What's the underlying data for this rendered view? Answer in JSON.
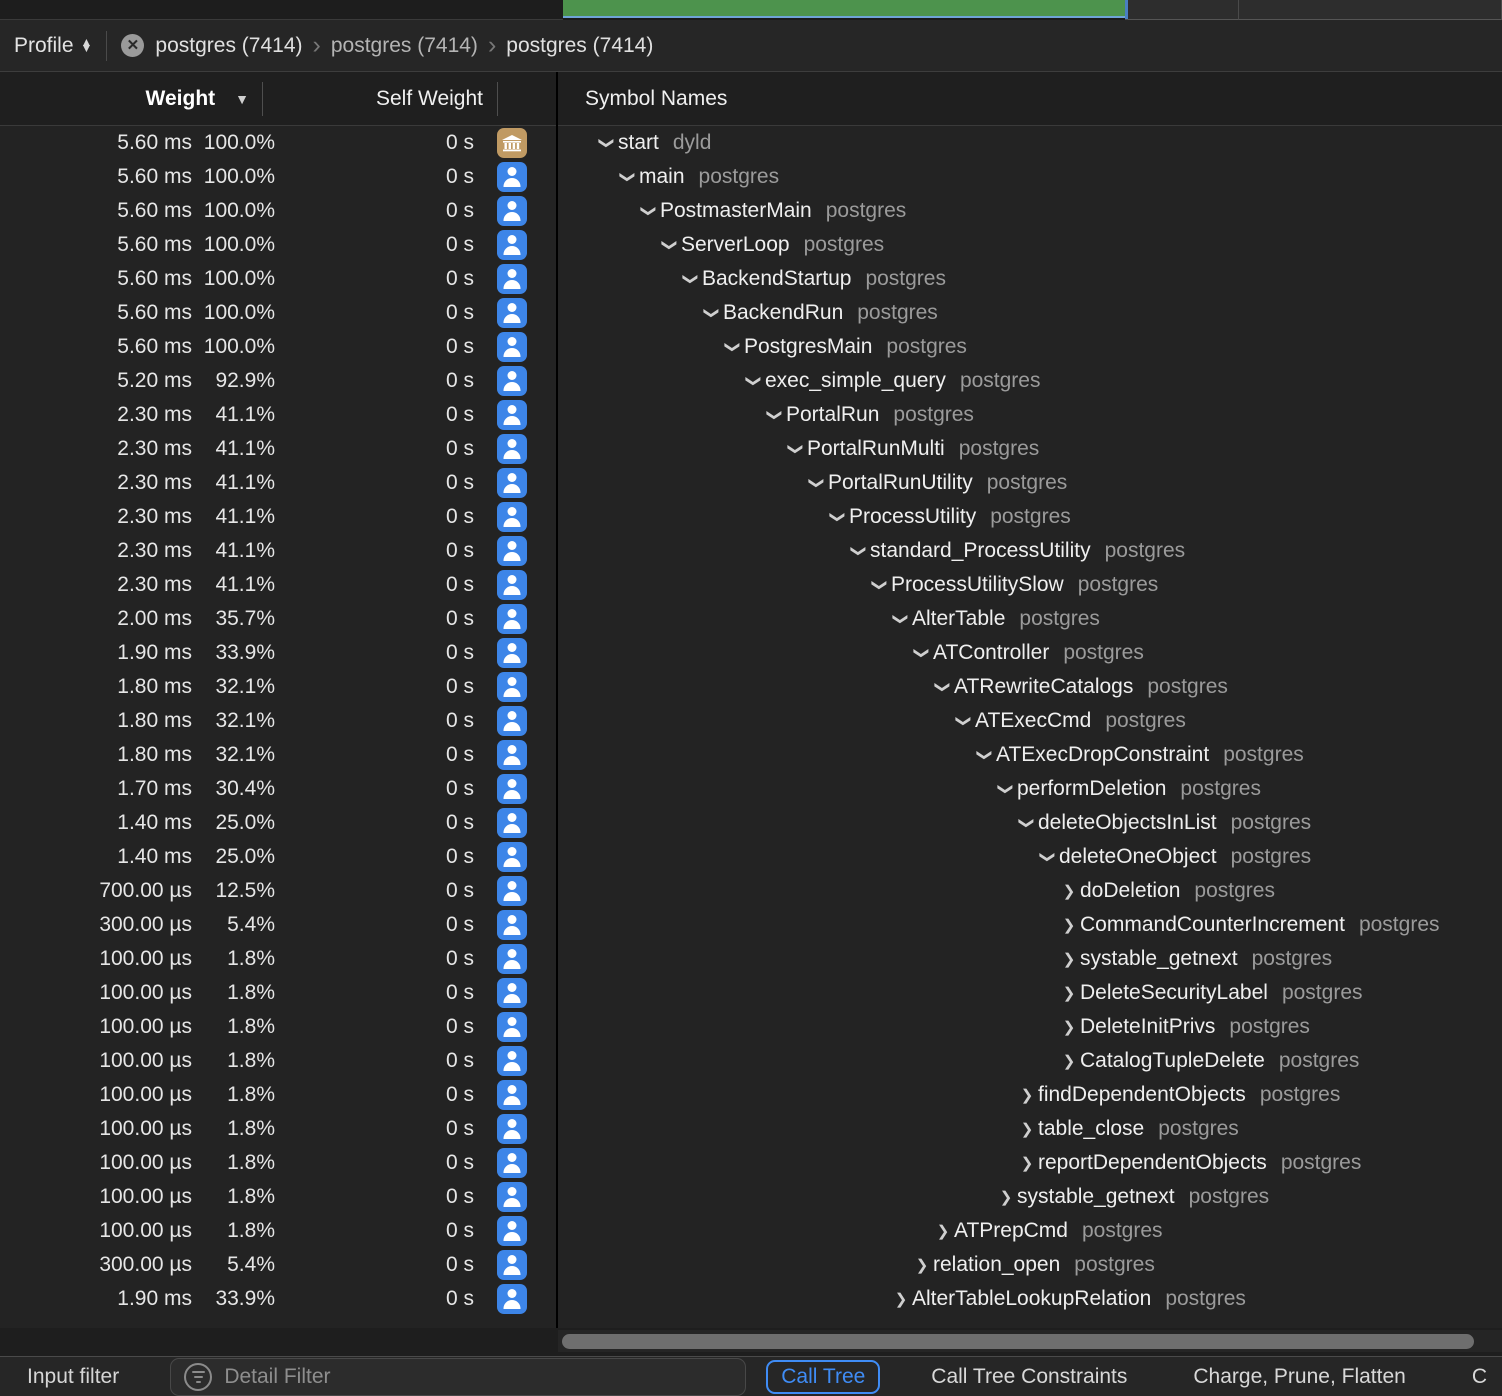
{
  "track": {
    "green_segment_label": "",
    "accent_green": "#4d934d",
    "selection_blue": "#4a7fc1"
  },
  "breadcrumb": {
    "profile_menu_label": "Profile",
    "stepper_icon": "up-down-chevrons-icon",
    "close_icon": "close-circle-icon",
    "separator": "›",
    "items": [
      {
        "label": "postgres (7414)"
      },
      {
        "label": "postgres (7414)"
      },
      {
        "label": "postgres (7414)"
      }
    ]
  },
  "columns": {
    "weight": "Weight",
    "weight_sort_icon": "chevron-down-icon",
    "self_weight": "Self Weight",
    "symbol_names": "Symbol Names"
  },
  "rows": [
    {
      "weight": "5.60 ms",
      "pct": "100.0%",
      "self": "0 s",
      "badge": "bank-icon",
      "depth": 0,
      "state": "expanded",
      "symbol": "start",
      "module": "dyld"
    },
    {
      "weight": "5.60 ms",
      "pct": "100.0%",
      "self": "0 s",
      "badge": "person-icon",
      "depth": 1,
      "state": "expanded",
      "symbol": "main",
      "module": "postgres"
    },
    {
      "weight": "5.60 ms",
      "pct": "100.0%",
      "self": "0 s",
      "badge": "person-icon",
      "depth": 2,
      "state": "expanded",
      "symbol": "PostmasterMain",
      "module": "postgres"
    },
    {
      "weight": "5.60 ms",
      "pct": "100.0%",
      "self": "0 s",
      "badge": "person-icon",
      "depth": 3,
      "state": "expanded",
      "symbol": "ServerLoop",
      "module": "postgres"
    },
    {
      "weight": "5.60 ms",
      "pct": "100.0%",
      "self": "0 s",
      "badge": "person-icon",
      "depth": 4,
      "state": "expanded",
      "symbol": "BackendStartup",
      "module": "postgres"
    },
    {
      "weight": "5.60 ms",
      "pct": "100.0%",
      "self": "0 s",
      "badge": "person-icon",
      "depth": 5,
      "state": "expanded",
      "symbol": "BackendRun",
      "module": "postgres"
    },
    {
      "weight": "5.60 ms",
      "pct": "100.0%",
      "self": "0 s",
      "badge": "person-icon",
      "depth": 6,
      "state": "expanded",
      "symbol": "PostgresMain",
      "module": "postgres"
    },
    {
      "weight": "5.20 ms",
      "pct": "92.9%",
      "self": "0 s",
      "badge": "person-icon",
      "depth": 7,
      "state": "expanded",
      "symbol": "exec_simple_query",
      "module": "postgres"
    },
    {
      "weight": "2.30 ms",
      "pct": "41.1%",
      "self": "0 s",
      "badge": "person-icon",
      "depth": 8,
      "state": "expanded",
      "symbol": "PortalRun",
      "module": "postgres"
    },
    {
      "weight": "2.30 ms",
      "pct": "41.1%",
      "self": "0 s",
      "badge": "person-icon",
      "depth": 9,
      "state": "expanded",
      "symbol": "PortalRunMulti",
      "module": "postgres"
    },
    {
      "weight": "2.30 ms",
      "pct": "41.1%",
      "self": "0 s",
      "badge": "person-icon",
      "depth": 10,
      "state": "expanded",
      "symbol": "PortalRunUtility",
      "module": "postgres"
    },
    {
      "weight": "2.30 ms",
      "pct": "41.1%",
      "self": "0 s",
      "badge": "person-icon",
      "depth": 11,
      "state": "expanded",
      "symbol": "ProcessUtility",
      "module": "postgres"
    },
    {
      "weight": "2.30 ms",
      "pct": "41.1%",
      "self": "0 s",
      "badge": "person-icon",
      "depth": 12,
      "state": "expanded",
      "symbol": "standard_ProcessUtility",
      "module": "postgres"
    },
    {
      "weight": "2.30 ms",
      "pct": "41.1%",
      "self": "0 s",
      "badge": "person-icon",
      "depth": 13,
      "state": "expanded",
      "symbol": "ProcessUtilitySlow",
      "module": "postgres"
    },
    {
      "weight": "2.00 ms",
      "pct": "35.7%",
      "self": "0 s",
      "badge": "person-icon",
      "depth": 14,
      "state": "expanded",
      "symbol": "AlterTable",
      "module": "postgres"
    },
    {
      "weight": "1.90 ms",
      "pct": "33.9%",
      "self": "0 s",
      "badge": "person-icon",
      "depth": 15,
      "state": "expanded",
      "symbol": "ATController",
      "module": "postgres"
    },
    {
      "weight": "1.80 ms",
      "pct": "32.1%",
      "self": "0 s",
      "badge": "person-icon",
      "depth": 16,
      "state": "expanded",
      "symbol": "ATRewriteCatalogs",
      "module": "postgres"
    },
    {
      "weight": "1.80 ms",
      "pct": "32.1%",
      "self": "0 s",
      "badge": "person-icon",
      "depth": 17,
      "state": "expanded",
      "symbol": "ATExecCmd",
      "module": "postgres"
    },
    {
      "weight": "1.80 ms",
      "pct": "32.1%",
      "self": "0 s",
      "badge": "person-icon",
      "depth": 18,
      "state": "expanded",
      "symbol": "ATExecDropConstraint",
      "module": "postgres"
    },
    {
      "weight": "1.70 ms",
      "pct": "30.4%",
      "self": "0 s",
      "badge": "person-icon",
      "depth": 19,
      "state": "expanded",
      "symbol": "performDeletion",
      "module": "postgres"
    },
    {
      "weight": "1.40 ms",
      "pct": "25.0%",
      "self": "0 s",
      "badge": "person-icon",
      "depth": 20,
      "state": "expanded",
      "symbol": "deleteObjectsInList",
      "module": "postgres"
    },
    {
      "weight": "1.40 ms",
      "pct": "25.0%",
      "self": "0 s",
      "badge": "person-icon",
      "depth": 21,
      "state": "expanded",
      "symbol": "deleteOneObject",
      "module": "postgres"
    },
    {
      "weight": "700.00 µs",
      "pct": "12.5%",
      "self": "0 s",
      "badge": "person-icon",
      "depth": 22,
      "state": "collapsed",
      "symbol": "doDeletion",
      "module": "postgres"
    },
    {
      "weight": "300.00 µs",
      "pct": "5.4%",
      "self": "0 s",
      "badge": "person-icon",
      "depth": 22,
      "state": "collapsed",
      "symbol": "CommandCounterIncrement",
      "module": "postgres"
    },
    {
      "weight": "100.00 µs",
      "pct": "1.8%",
      "self": "0 s",
      "badge": "person-icon",
      "depth": 22,
      "state": "collapsed",
      "symbol": "systable_getnext",
      "module": "postgres"
    },
    {
      "weight": "100.00 µs",
      "pct": "1.8%",
      "self": "0 s",
      "badge": "person-icon",
      "depth": 22,
      "state": "collapsed",
      "symbol": "DeleteSecurityLabel",
      "module": "postgres"
    },
    {
      "weight": "100.00 µs",
      "pct": "1.8%",
      "self": "0 s",
      "badge": "person-icon",
      "depth": 22,
      "state": "collapsed",
      "symbol": "DeleteInitPrivs",
      "module": "postgres"
    },
    {
      "weight": "100.00 µs",
      "pct": "1.8%",
      "self": "0 s",
      "badge": "person-icon",
      "depth": 22,
      "state": "collapsed",
      "symbol": "CatalogTupleDelete",
      "module": "postgres"
    },
    {
      "weight": "100.00 µs",
      "pct": "1.8%",
      "self": "0 s",
      "badge": "person-icon",
      "depth": 20,
      "state": "collapsed",
      "symbol": "findDependentObjects",
      "module": "postgres"
    },
    {
      "weight": "100.00 µs",
      "pct": "1.8%",
      "self": "0 s",
      "badge": "person-icon",
      "depth": 20,
      "state": "collapsed",
      "symbol": "table_close",
      "module": "postgres"
    },
    {
      "weight": "100.00 µs",
      "pct": "1.8%",
      "self": "0 s",
      "badge": "person-icon",
      "depth": 20,
      "state": "collapsed",
      "symbol": "reportDependentObjects",
      "module": "postgres"
    },
    {
      "weight": "100.00 µs",
      "pct": "1.8%",
      "self": "0 s",
      "badge": "person-icon",
      "depth": 19,
      "state": "collapsed",
      "symbol": "systable_getnext",
      "module": "postgres"
    },
    {
      "weight": "100.00 µs",
      "pct": "1.8%",
      "self": "0 s",
      "badge": "person-icon",
      "depth": 16,
      "state": "collapsed",
      "symbol": "ATPrepCmd",
      "module": "postgres"
    },
    {
      "weight": "300.00 µs",
      "pct": "5.4%",
      "self": "0 s",
      "badge": "person-icon",
      "depth": 15,
      "state": "collapsed",
      "symbol": "relation_open",
      "module": "postgres"
    },
    {
      "weight": "1.90 ms",
      "pct": "33.9%",
      "self": "0 s",
      "badge": "person-icon",
      "depth": 14,
      "state": "collapsed",
      "symbol": "AlterTableLookupRelation",
      "module": "postgres"
    }
  ],
  "scrollbars": {
    "horizontal_thumb": "horizontal-scrollbar-thumb"
  },
  "bottom": {
    "input_filter_label": "Input filter",
    "detail_filter_icon": "filter-icon",
    "detail_filter_value": "",
    "detail_filter_placeholder": "Detail Filter",
    "actions": [
      {
        "label": "Call Tree",
        "active": true
      },
      {
        "label": "Call Tree Constraints",
        "active": false
      },
      {
        "label": "Charge, Prune, Flatten",
        "active": false
      },
      {
        "label": "C",
        "active": false
      }
    ]
  }
}
